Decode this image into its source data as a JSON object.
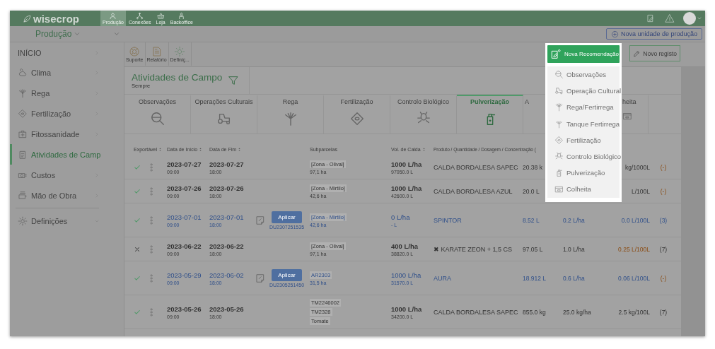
{
  "topbar": {
    "logo": "wisecrop",
    "nav": [
      {
        "label": "Produção",
        "selected": true
      },
      {
        "label": "Conexões",
        "selected": false
      },
      {
        "label": "Loja",
        "selected": false
      },
      {
        "label": "Backoffice",
        "selected": false
      }
    ]
  },
  "subbar": {
    "unit": "Produção",
    "new_unit_button": "Nova unidade de produção"
  },
  "sidebar": {
    "items": [
      {
        "label": "INÍCIO",
        "selected": false
      },
      {
        "label": "Clima",
        "selected": false
      },
      {
        "label": "Rega",
        "selected": false
      },
      {
        "label": "Fertilização",
        "selected": false
      },
      {
        "label": "Fitossanidade",
        "selected": false
      },
      {
        "label": "Atividades de Camp",
        "selected": true
      },
      {
        "label": "Custos",
        "selected": false
      },
      {
        "label": "Mão de Obra",
        "selected": false
      }
    ],
    "settings": "Definições"
  },
  "toolbar": [
    {
      "label": "Suporte"
    },
    {
      "label": "Relatório"
    },
    {
      "label": "Definiç..."
    }
  ],
  "new_recommendation": {
    "label": "Nova Recomendação",
    "expanded": true,
    "menu": [
      "Observações",
      "Operação Cultural",
      "Rega/Fertirrega",
      "Tanque Fertirrega",
      "Fertilização",
      "Controlo Biológico",
      "Pulverização",
      "Colheita"
    ]
  },
  "new_record_button": "Novo registo",
  "page": {
    "title": "Atividades de Campo",
    "period": "Sempre"
  },
  "tabs": [
    {
      "label": "Observações",
      "selected": false
    },
    {
      "label": "Operações Culturais",
      "selected": false
    },
    {
      "label": "Rega",
      "selected": false
    },
    {
      "label": "Fertilização",
      "selected": false
    },
    {
      "label": "Controlo Biológico",
      "selected": false
    },
    {
      "label": "Pulverização",
      "selected": true
    },
    {
      "label": "A",
      "selected": false
    },
    {
      "label": "heita",
      "selected": false
    }
  ],
  "table": {
    "columns": [
      "Exportável",
      "Data de Início",
      "Data de Fim",
      "Subparcelas",
      "Vol. de Calda",
      "Produto / Quantidade / Dosagem / Concentração ("
    ],
    "rows": [
      {
        "kind": "record",
        "exportable": true,
        "start": "2023-07-27",
        "start_time": "09:00",
        "end": "2023-07-27",
        "end_time": "18:00",
        "subparcels": [
          "[Zona - Olival]"
        ],
        "area": "97,1 ha",
        "volume": "1000 L/ha",
        "volume_total": "97050.0 L",
        "product": "CALDA BORDALESA SAPEC",
        "quantity": "20.38 k",
        "concentration": "kg/1000L",
        "conc_alert": false,
        "count": "(-)",
        "count_alert": true
      },
      {
        "kind": "record",
        "exportable": true,
        "start": "2023-07-26",
        "start_time": "09:00",
        "end": "2023-07-26",
        "end_time": "18:00",
        "subparcels": [
          "[Zona - Mirtilo]"
        ],
        "area": "42,6 ha",
        "volume": "1000 L/ha",
        "volume_total": "42600.0 L",
        "product": "CALDA BORDALESA AZUL",
        "quantity": "20.0 L",
        "concentration": "L/100L",
        "conc_alert": false,
        "count": "(-)",
        "count_alert": true
      },
      {
        "kind": "recommendation",
        "exportable": true,
        "start": "2023-07-01",
        "start_time": "09:00",
        "end": "2023-07-01",
        "end_time": "18:00",
        "apply": "Aplicar",
        "code": "DU2307251535",
        "subparcels": [
          "[Zona - Mirtilo]"
        ],
        "area": "42,6 ha",
        "volume": "0 L/ha",
        "volume_total": "- L",
        "product": "SPINTOR",
        "quantity": "8.52 L",
        "dose": "0.2 L/ha",
        "concentration": "0.0 L/100L",
        "conc_alert": false,
        "count": "(3)",
        "count_alert": false
      },
      {
        "kind": "record",
        "exportable": false,
        "start": "2023-06-22",
        "start_time": "09:00",
        "end": "2023-06-22",
        "end_time": "18:00",
        "subparcels": [
          "[Zona - Olival]"
        ],
        "area": "97,1 ha",
        "volume": "400 L/ha",
        "volume_total": "38820.0 L",
        "product": "✖ KARATE ZEON + 1,5 CS",
        "quantity": "97.05 L",
        "dose": "1.0 L/ha",
        "concentration": "0.25 L/100L",
        "conc_alert": true,
        "count": "(7)",
        "count_alert": false
      },
      {
        "kind": "recommendation",
        "exportable": true,
        "start": "2023-05-29",
        "start_time": "09:00",
        "end": "2023-06-02",
        "end_time": "18:00",
        "apply": "Aplicar",
        "code": "DU2305251450",
        "subparcels": [
          "AR2303"
        ],
        "area": "31,5 ha",
        "volume": "1000 L/ha",
        "volume_total": "31570.0 L",
        "product": "AURA",
        "quantity": "18.912 L",
        "dose": "0.6 L/ha",
        "concentration": "0.06 L/100L",
        "conc_alert": false,
        "count": "(-)",
        "count_alert": true
      },
      {
        "kind": "record",
        "exportable": true,
        "start": "2023-05-26",
        "start_time": "09:00",
        "end": "2023-05-26",
        "end_time": "18:00",
        "subparcels": [
          "TM2246002",
          "TM2328",
          "Tomate"
        ],
        "volume": "1000 L/ha",
        "volume_total": "34200.0 L",
        "product": "CALDA BORDALESA SAPEC",
        "quantity": "855.0 kg",
        "dose": "25.0 kg/ha",
        "concentration": "2.5 kg/100L",
        "conc_alert": false,
        "count": "(7)",
        "count_alert": false
      }
    ]
  }
}
